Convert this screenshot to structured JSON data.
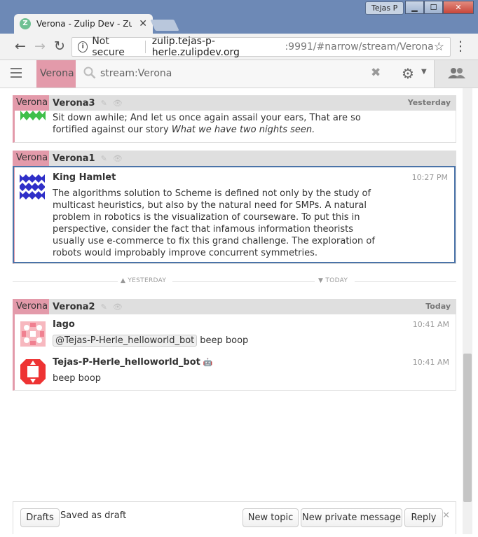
{
  "window": {
    "user": "Tejas P",
    "minimize": "▁",
    "maximize": "☐",
    "close": "✕"
  },
  "tab": {
    "title": "Verona - Zulip Dev - Zulip",
    "favicon": "Z",
    "close": "✕"
  },
  "navbar": {
    "back_icon": "←",
    "forward_icon": "→",
    "reload_icon": "↻",
    "info_icon": "i",
    "security": "Not secure",
    "url_host": "zulip.tejas-p-herle.zulipdev.org",
    "url_path": ":9991/#narrow/stream/Verona",
    "star_icon": "☆",
    "menu_icon": "⋮"
  },
  "header": {
    "stream": "Verona",
    "search": "stream:Verona",
    "clear": "✖",
    "gear": "⚙",
    "caret": "▼",
    "users": "👥"
  },
  "recipients": [
    {
      "stream": "Verona",
      "topic": "Verona3",
      "date": "Yesterday",
      "messages": [
        {
          "sender": "",
          "time": "",
          "content": "Sit down awhile; And let us once again assail your ears, That are so fortified against our story ",
          "content_em": "What we have two nights seen."
        }
      ]
    },
    {
      "stream": "Verona",
      "topic": "Verona1",
      "date": "",
      "messages": [
        {
          "sender": "King Hamlet",
          "time": "10:27 PM",
          "content": "The algorithms solution to Scheme is defined not only by the study of multicast heuristics, but also by the natural need for SMPs. A natural problem in robotics is the visualization of courseware. To put this in perspective, consider the fact that infamous information theorists usually use e-commerce to fix this grand challenge. The exploration of robots would improbably improve concurrent symmetries."
        }
      ]
    },
    {
      "stream": "Verona",
      "topic": "Verona2",
      "date": "Today",
      "messages": [
        {
          "sender": "Iago",
          "time": "10:41 AM",
          "mention": "@Tejas-P-Herle_helloworld_bot",
          "content": "beep boop"
        },
        {
          "sender": "Tejas-P-Herle_helloworld_bot",
          "time": "10:41 AM",
          "content": "beep boop"
        }
      ]
    }
  ],
  "divider": {
    "left": "▲ YESTERDAY",
    "right": "▼ TODAY"
  },
  "compose": {
    "drafts": "Drafts",
    "saved": "Saved as draft",
    "new_topic": "New topic",
    "new_pm": "New private message",
    "reply": "Reply",
    "close": "✕"
  },
  "icons": {
    "edit": "✎",
    "mute": "👁",
    "bot": "🤖"
  }
}
